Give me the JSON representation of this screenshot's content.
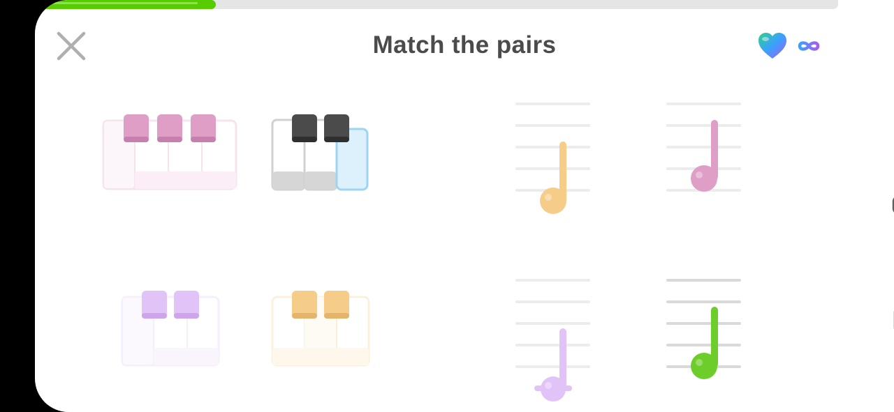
{
  "header": {
    "title": "Match the pairs",
    "progress_fraction": 0.22
  },
  "icons": {
    "close": "close-icon",
    "hearts": "heart-icon",
    "hearts_value": "infinity-icon"
  },
  "colors": {
    "progress": "#58cc02",
    "pink": "#de9ec6",
    "dark": "#444444",
    "blue": "#b9def2",
    "purple": "#e2c3f7",
    "orange": "#f6cd88",
    "green": "#6ccd2b",
    "text": "#4b4b4b"
  },
  "left_cards": [
    {
      "name": "pink-keys",
      "color": "pink",
      "state": "matched"
    },
    {
      "name": "dark-keys",
      "color": "dark",
      "state": "selected"
    },
    {
      "name": "purple-keys",
      "color": "purple",
      "state": "matched"
    },
    {
      "name": "orange-keys",
      "color": "orange",
      "state": "matched"
    }
  ],
  "right_cards": [
    {
      "name": "orange-note",
      "color": "orange",
      "state": "matched"
    },
    {
      "name": "pink-note",
      "color": "pink",
      "state": "matched"
    },
    {
      "name": "purple-note",
      "color": "purple",
      "state": "matched"
    },
    {
      "name": "green-note",
      "color": "green",
      "state": "active"
    }
  ],
  "system_nav": [
    "back-icon",
    "home-icon",
    "recent-apps-icon"
  ]
}
